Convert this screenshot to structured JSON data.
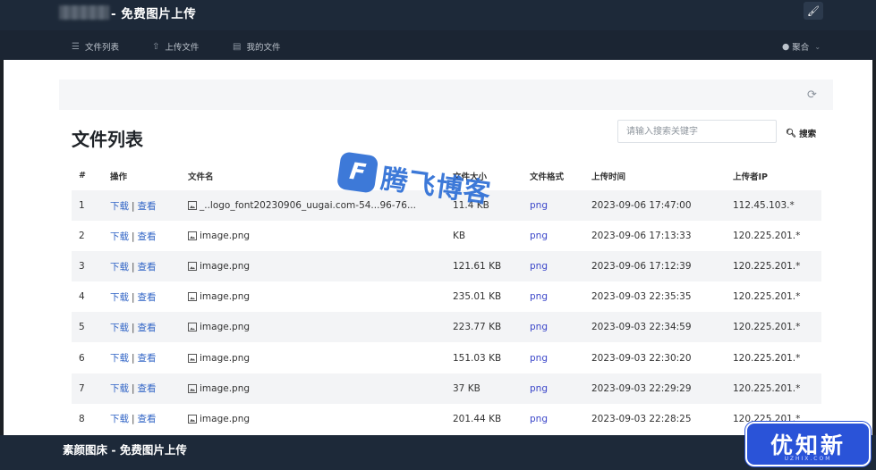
{
  "header": {
    "app_title": "- 免费图片上传",
    "brush_icon": "paintbrush-icon"
  },
  "nav": {
    "items": [
      {
        "label": "文件列表",
        "icon": "list-icon"
      },
      {
        "label": "上传文件",
        "icon": "upload-icon"
      },
      {
        "label": "我的文件",
        "icon": "file-icon"
      }
    ],
    "user": "聚合"
  },
  "page": {
    "title": "文件列表",
    "search_placeholder": "请输入搜索关键字",
    "search_button": "搜索"
  },
  "table": {
    "columns": [
      "#",
      "操作",
      "文件名",
      "文件大小",
      "文件格式",
      "上传时间",
      "上传者IP"
    ],
    "action_download": "下载",
    "action_view": "查看",
    "action_sep": "|",
    "rows": [
      {
        "no": "1",
        "name": "_..logo_font20230906_uugai.com-54...96-76...",
        "size": "11.4 KB",
        "fmt": "png",
        "time": "2023-09-06 17:47:00",
        "ip": "112.45.103.*"
      },
      {
        "no": "2",
        "name": "image.png",
        "size": "KB",
        "fmt": "png",
        "time": "2023-09-06 17:13:33",
        "ip": "120.225.201.*"
      },
      {
        "no": "3",
        "name": "image.png",
        "size": "121.61 KB",
        "fmt": "png",
        "time": "2023-09-06 17:12:39",
        "ip": "120.225.201.*"
      },
      {
        "no": "4",
        "name": "image.png",
        "size": "235.01 KB",
        "fmt": "png",
        "time": "2023-09-03 22:35:35",
        "ip": "120.225.201.*"
      },
      {
        "no": "5",
        "name": "image.png",
        "size": "223.77 KB",
        "fmt": "png",
        "time": "2023-09-03 22:34:59",
        "ip": "120.225.201.*"
      },
      {
        "no": "6",
        "name": "image.png",
        "size": "151.03 KB",
        "fmt": "png",
        "time": "2023-09-03 22:30:20",
        "ip": "120.225.201.*"
      },
      {
        "no": "7",
        "name": "image.png",
        "size": "37 KB",
        "fmt": "png",
        "time": "2023-09-03 22:29:29",
        "ip": "120.225.201.*"
      },
      {
        "no": "8",
        "name": "image.png",
        "size": "201.44 KB",
        "fmt": "png",
        "time": "2023-09-03 22:28:25",
        "ip": "120.225.201.*"
      }
    ]
  },
  "watermark": {
    "logo_letter": "F",
    "text": "腾飞博客"
  },
  "footer": {
    "text": "素颜图床 - 免费图片上传"
  },
  "badge": {
    "text": "优知新",
    "sub": "UZHIX.COM"
  },
  "colors": {
    "header_bg": "#1d2939",
    "link": "#3265c6",
    "format": "#3b46c9",
    "badge": "#2a53d8"
  }
}
